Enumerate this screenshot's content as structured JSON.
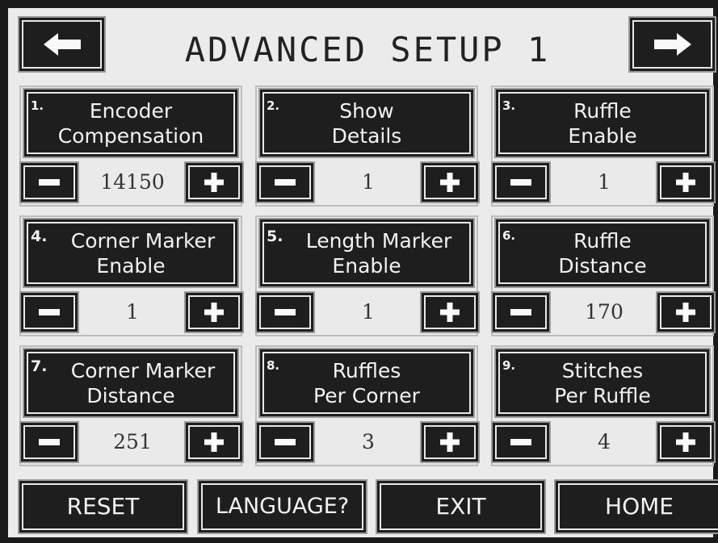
{
  "header": {
    "title": "ADVANCED SETUP 1",
    "prev_icon": "arrow-left-icon",
    "next_icon": "arrow-right-icon"
  },
  "params": [
    {
      "number": "1.",
      "line1": "Encoder",
      "line2": "Compensation",
      "value": "14150"
    },
    {
      "number": "2.",
      "line1": "Show",
      "line2": "Details",
      "value": "1"
    },
    {
      "number": "3.",
      "line1": "Ruffle",
      "line2": "Enable",
      "value": "1"
    },
    {
      "number": "4.",
      "line1": "Corner Marker",
      "line2": "Enable",
      "value": "1"
    },
    {
      "number": "5.",
      "line1": "Length Marker",
      "line2": "Enable",
      "value": "1"
    },
    {
      "number": "6.",
      "line1": "Ruffle",
      "line2": "Distance",
      "value": "170"
    },
    {
      "number": "7.",
      "line1": "Corner Marker",
      "line2": "Distance",
      "value": "251"
    },
    {
      "number": "8.",
      "line1": "Ruffles",
      "line2": "Per Corner",
      "value": "3"
    },
    {
      "number": "9.",
      "line1": "Stitches",
      "line2": "Per Ruffle",
      "value": "4"
    }
  ],
  "stepper": {
    "minus_icon": "minus-icon",
    "plus_icon": "plus-icon"
  },
  "footer": {
    "reset_label": "RESET",
    "language_label": "LANGUAGE?",
    "exit_label": "EXIT",
    "home_label": "HOME"
  }
}
